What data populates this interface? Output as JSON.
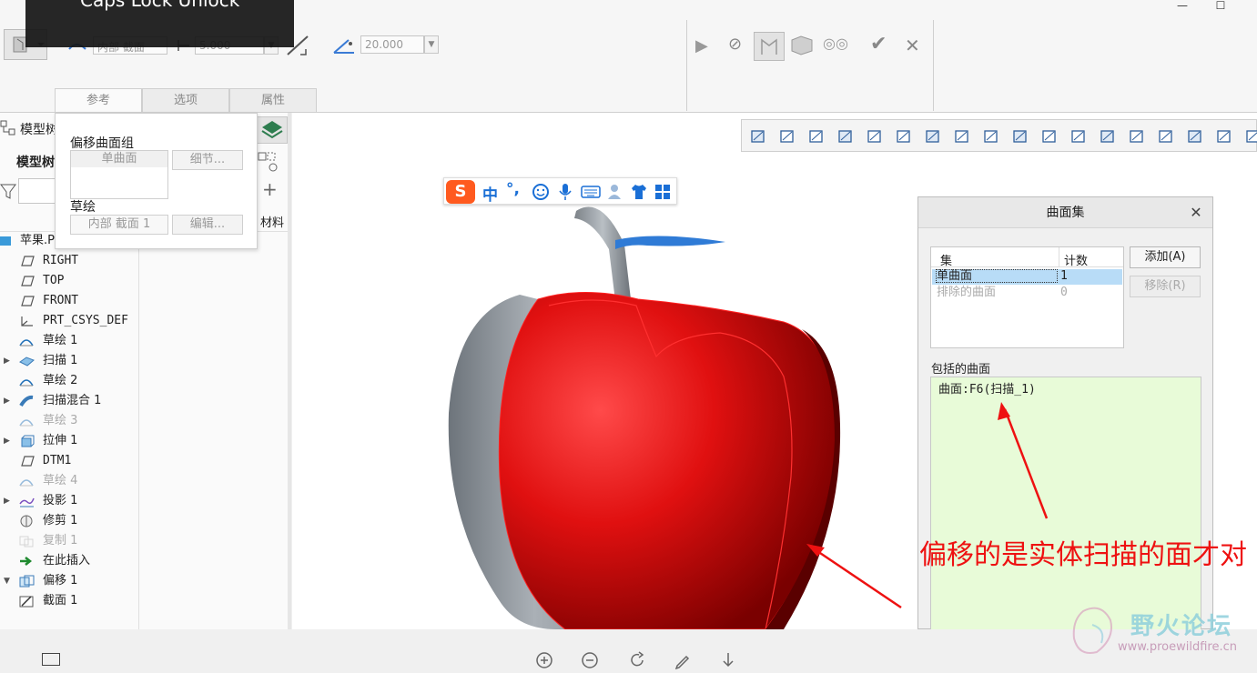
{
  "tooltip": {
    "caps_lock": "Caps Lock Unlock"
  },
  "ribbon": {
    "offset_type": "内部 截面",
    "offset_value": "5.000",
    "angle_value": "20.000",
    "tabs": [
      "参考",
      "选项",
      "属性"
    ]
  },
  "ref_popup": {
    "offset_surface_group_label": "偏移曲面组",
    "surface_value": "单曲面",
    "details_button": "细节...",
    "sketch_label": "草绘",
    "sketch_value": "内部 截面 1",
    "edit_button": "编辑..."
  },
  "model_tree": {
    "header_title": "模型树",
    "header_sub": "模型树",
    "material_col": "材料",
    "items": [
      {
        "label": "苹果.PRT",
        "icon": "part-icon",
        "expand": "",
        "dim": false
      },
      {
        "label": "RIGHT",
        "icon": "datum-plane-icon",
        "expand": "",
        "dim": false
      },
      {
        "label": "TOP",
        "icon": "datum-plane-icon",
        "expand": "",
        "dim": false
      },
      {
        "label": "FRONT",
        "icon": "datum-plane-icon",
        "expand": "",
        "dim": false
      },
      {
        "label": "PRT_CSYS_DEF",
        "icon": "csys-icon",
        "expand": "",
        "dim": false
      },
      {
        "label": "草绘 1",
        "icon": "sketch-icon",
        "expand": "",
        "dim": false
      },
      {
        "label": "扫描 1",
        "icon": "sweep-icon",
        "expand": "▶",
        "dim": false
      },
      {
        "label": "草绘 2",
        "icon": "sketch-icon",
        "expand": "",
        "dim": false
      },
      {
        "label": "扫描混合 1",
        "icon": "swept-blend-icon",
        "expand": "▶",
        "dim": false
      },
      {
        "label": "草绘 3",
        "icon": "sketch-icon",
        "expand": "",
        "dim": true
      },
      {
        "label": "拉伸 1",
        "icon": "extrude-icon",
        "expand": "▶",
        "dim": false
      },
      {
        "label": "DTM1",
        "icon": "datum-plane-icon",
        "expand": "",
        "dim": false
      },
      {
        "label": "草绘 4",
        "icon": "sketch-icon",
        "expand": "",
        "dim": true
      },
      {
        "label": "投影 1",
        "icon": "projection-icon",
        "expand": "▶",
        "dim": false
      },
      {
        "label": "修剪 1",
        "icon": "trim-icon",
        "expand": "",
        "dim": false
      },
      {
        "label": "复制 1",
        "icon": "copy-icon",
        "expand": "",
        "dim": true
      },
      {
        "label": "在此插入",
        "icon": "insert-arrow-icon",
        "expand": "",
        "dim": false
      },
      {
        "label": "偏移 1",
        "icon": "offset-icon",
        "expand": "▼",
        "dim": false
      },
      {
        "label": "截面 1",
        "icon": "section-sketch-icon",
        "expand": "",
        "dim": false
      }
    ]
  },
  "ime": {
    "logo": "S",
    "mode": "中",
    "punct": "°,"
  },
  "dialog": {
    "title": "曲面集",
    "col_set": "集",
    "col_count": "计数",
    "rows": [
      {
        "name": "单曲面",
        "count": "1"
      },
      {
        "name": "排除的曲面",
        "count": "0"
      }
    ],
    "add_button": "添加(A)",
    "remove_button": "移除(R)",
    "included_label": "包括的曲面",
    "included_item": "曲面:F6(扫描_1)"
  },
  "annotation": {
    "text": "偏移的是实体扫描的面才对"
  },
  "watermark": {
    "title": "野火论坛",
    "url": "www.proewildfire.cn"
  },
  "colors": {
    "apple_red": "#e01010",
    "annotation_red": "#ee1111",
    "included_bg": "#e8fbd8",
    "selection_blue": "#b8dcf7"
  }
}
